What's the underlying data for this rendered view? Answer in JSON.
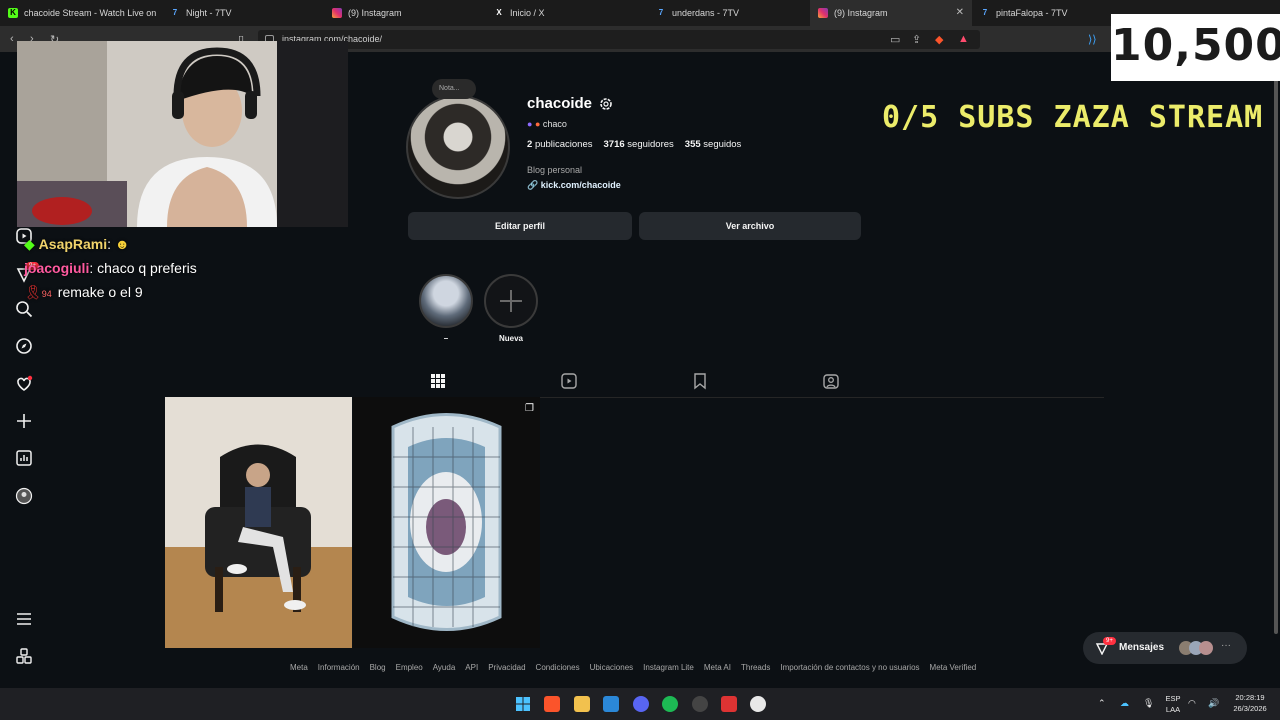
{
  "browser": {
    "tabs": [
      {
        "label": "chacoide Stream - Watch Live on",
        "favicon": "kick-icon",
        "color": "#53fc18"
      },
      {
        "label": "Night - 7TV",
        "favicon": "7tv-icon",
        "color": "#5aa7ff"
      },
      {
        "label": "(9) Instagram",
        "favicon": "instagram-icon",
        "color": "#e1306c"
      },
      {
        "label": "Inicio / X",
        "favicon": "x-icon",
        "color": "#ffffff"
      },
      {
        "label": "underdans - 7TV",
        "favicon": "7tv-icon",
        "color": "#5aa7ff"
      },
      {
        "label": "(9) Instagram",
        "favicon": "instagram-icon",
        "color": "#e1306c",
        "active": true
      },
      {
        "label": "pintaFalopa - 7TV",
        "favicon": "7tv-icon",
        "color": "#5aa7ff"
      }
    ],
    "url": "instagram.com/chacoide/"
  },
  "profile": {
    "note": "Nota...",
    "username": "chacoide",
    "threads_name": "chaco",
    "posts_count": "2",
    "posts_label": "publicaciones",
    "followers_count": "3716",
    "followers_label": "seguidores",
    "following_count": "355",
    "following_label": "seguidos",
    "category": "Blog personal",
    "link": "kick.com/chacoide",
    "edit_button": "Editar perfil",
    "archive_button": "Ver archivo"
  },
  "highlights": [
    {
      "label": "–"
    },
    {
      "label": "Nueva"
    }
  ],
  "footer_links": [
    "Meta",
    "Información",
    "Blog",
    "Empleo",
    "Ayuda",
    "API",
    "Privacidad",
    "Condiciones",
    "Ubicaciones",
    "Instagram Lite",
    "Meta AI",
    "Threads",
    "Importación de contactos y no usuarios",
    "Meta Verified"
  ],
  "messages": {
    "label": "Mensajes",
    "badge": "9+"
  },
  "stream_overlay": {
    "counter": "10,500",
    "subs_goal": "0/5 SUBS ZAZA STREAM",
    "chat": [
      {
        "user": "AsapRami",
        "text": ""
      },
      {
        "user": "joacogiuli",
        "text": "chaco q preferis"
      },
      {
        "user": "",
        "badge": "94",
        "text": "remake o el 9"
      }
    ]
  },
  "sidebar_badge": "9+",
  "taskbar": {
    "lang_top": "ESP",
    "lang_bottom": "LAA",
    "time": "20:28:19",
    "date": "26/3/2026"
  },
  "colors": {
    "background": "#0c1014",
    "button": "#25292e",
    "goal_text": "#ecec6a",
    "kick_green": "#53fc18"
  }
}
